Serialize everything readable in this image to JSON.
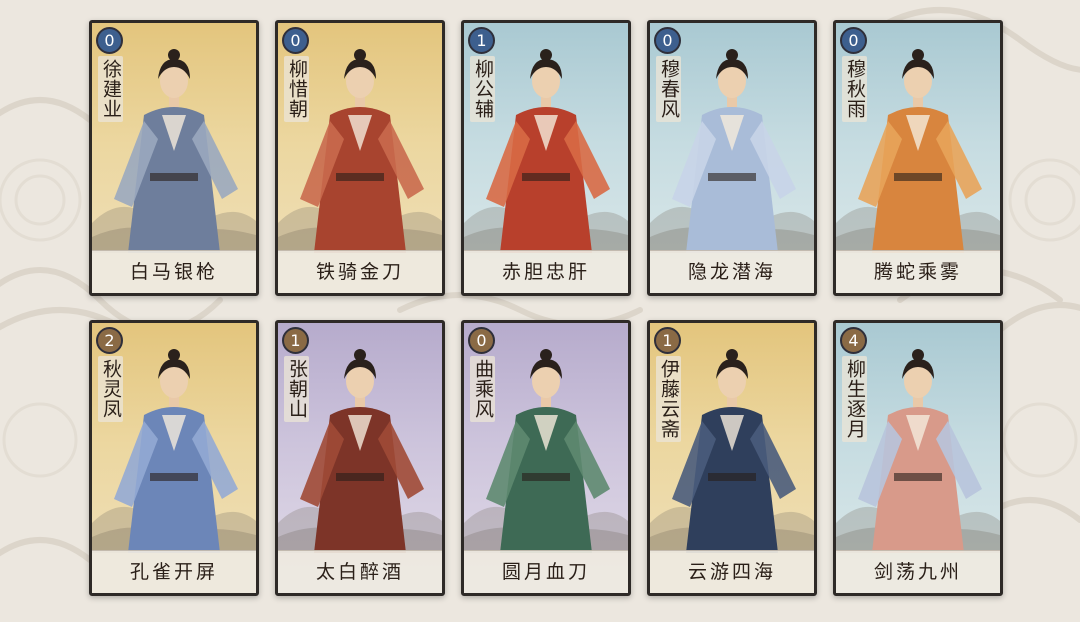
{
  "cards": [
    {
      "cost": "0",
      "name": "徐建业",
      "title": "白马银枪",
      "theme": "gold",
      "cost_color": "blue",
      "robe": "#6e7e9c",
      "accent": "#9aa8bf"
    },
    {
      "cost": "0",
      "name": "柳惜朝",
      "title": "铁骑金刀",
      "theme": "gold",
      "cost_color": "blue",
      "robe": "#a8442f",
      "accent": "#c96a4e"
    },
    {
      "cost": "1",
      "name": "柳公辅",
      "title": "赤胆忠肝",
      "theme": "blue",
      "cost_color": "blue",
      "robe": "#b8402c",
      "accent": "#d86a45"
    },
    {
      "cost": "0",
      "name": "穆春风",
      "title": "隐龙潜海",
      "theme": "blue",
      "cost_color": "blue",
      "robe": "#a9bcd8",
      "accent": "#c8d4e8"
    },
    {
      "cost": "0",
      "name": "穆秋雨",
      "title": "腾蛇乘雾",
      "theme": "blue",
      "cost_color": "blue",
      "robe": "#d8853e",
      "accent": "#e8a45a"
    },
    {
      "cost": "2",
      "name": "秋灵凤",
      "title": "孔雀开屏",
      "theme": "gold",
      "cost_color": "bronze",
      "robe": "#6c86b8",
      "accent": "#93aad4"
    },
    {
      "cost": "1",
      "name": "张朝山",
      "title": "太白醉酒",
      "theme": "purple",
      "cost_color": "bronze",
      "robe": "#7d3428",
      "accent": "#a04a36"
    },
    {
      "cost": "0",
      "name": "曲乘风",
      "title": "圆月血刀",
      "theme": "purple",
      "cost_color": "bronze",
      "robe": "#3e6a55",
      "accent": "#5e8a70"
    },
    {
      "cost": "1",
      "name": "伊藤云斋",
      "title": "云游四海",
      "theme": "gold",
      "cost_color": "bronze",
      "robe": "#2f3f5c",
      "accent": "#4a5c7c"
    },
    {
      "cost": "4",
      "name": "柳生逐月",
      "title": "剑荡九州",
      "theme": "blue",
      "cost_color": "bronze",
      "robe": "#d89a8a",
      "accent": "#b8c4dc"
    }
  ]
}
